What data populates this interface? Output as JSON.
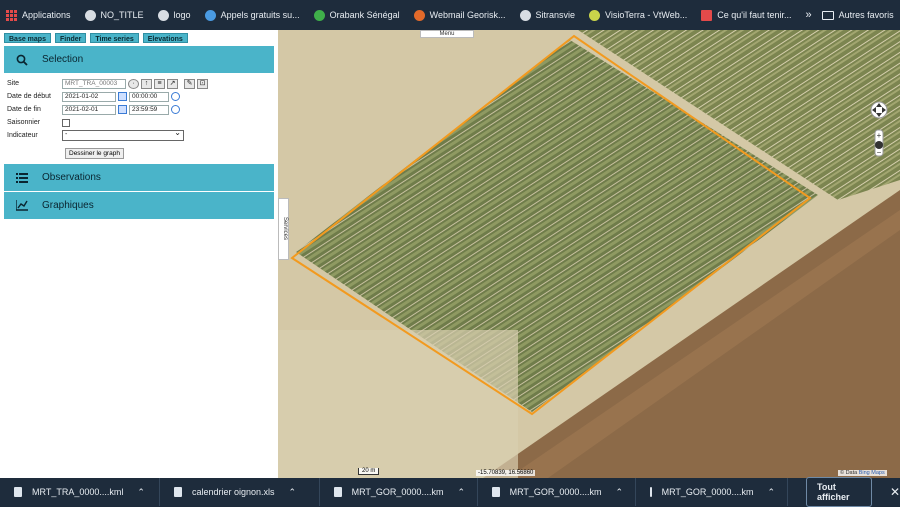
{
  "bookmarks": {
    "items": [
      {
        "label": "Applications",
        "color": "#e34a4a"
      },
      {
        "label": "NO_TITLE",
        "color": "#d8dde3"
      },
      {
        "label": "logo",
        "color": "#d8dde3"
      },
      {
        "label": "Appels gratuits su...",
        "color": "#4a9be3"
      },
      {
        "label": "Orabank Sénégal",
        "color": "#3fb04a"
      },
      {
        "label": "Webmail Georisk...",
        "color": "#e36a2a"
      },
      {
        "label": "Sitransvie",
        "color": "#d8dde3"
      },
      {
        "label": "VisioTerra - VtWeb...",
        "color": "#c9d44a"
      },
      {
        "label": "Ce qu'il faut tenir...",
        "color": "#e34a4a"
      }
    ],
    "overflow": "»",
    "other_label": "Autres favoris"
  },
  "panel": {
    "tabs": [
      "Base maps",
      "Finder",
      "Time series",
      "Elevations"
    ],
    "selection_label": "Selection",
    "form": {
      "site_label": "Site",
      "site_value": "MRT_TRA_00003",
      "start_label": "Date de début",
      "start_date": "2021-01-02",
      "start_time": "00:00:00",
      "end_label": "Date de fin",
      "end_date": "2021-02-01",
      "end_time": "23:59:59",
      "seasonal_label": "Saisonnier",
      "indicator_label": "Indicateur",
      "indicator_value": "-",
      "draw_button": "Dessiner le graph"
    },
    "observations_label": "Observations",
    "charts_label": "Graphiques"
  },
  "map": {
    "menu_label": "Menu",
    "services_label": "Services",
    "scale_label": "20 m",
    "coords": "-15.70839, 16.56860",
    "attribution_prefix": "© Data",
    "attribution_link": "Bing Maps",
    "polygon_color": "#f29a1f"
  },
  "downloads": {
    "items": [
      {
        "name": "MRT_TRA_0000....kml"
      },
      {
        "name": "calendrier oignon.xls"
      },
      {
        "name": "MRT_GOR_0000....km"
      },
      {
        "name": "MRT_GOR_0000....km"
      },
      {
        "name": "MRT_GOR_0000....km"
      }
    ],
    "show_all": "Tout afficher"
  }
}
